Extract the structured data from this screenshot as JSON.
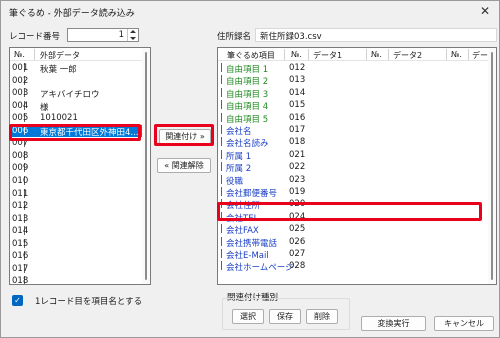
{
  "window": {
    "title": "筆ぐるめ - 外部データ読み込み",
    "close_glyph": "✕"
  },
  "record": {
    "label": "レコード番号",
    "value": "1"
  },
  "file": {
    "label": "住所録名",
    "value": "新住所録03.csv"
  },
  "left_list": {
    "headers": {
      "no": "№.",
      "data": "外部データ"
    },
    "rows": [
      {
        "no": "001",
        "text": "秋葉 一郎"
      },
      {
        "no": "002",
        "text": ""
      },
      {
        "no": "003",
        "text": "アキバイチロウ"
      },
      {
        "no": "004",
        "text": "様"
      },
      {
        "no": "005",
        "text": "1010021"
      },
      {
        "no": "006",
        "text": "東京都千代田区外神田4..."
      },
      {
        "no": "007",
        "text": ""
      },
      {
        "no": "008",
        "text": ""
      },
      {
        "no": "009",
        "text": ""
      },
      {
        "no": "010",
        "text": ""
      },
      {
        "no": "011",
        "text": ""
      },
      {
        "no": "012",
        "text": ""
      },
      {
        "no": "013",
        "text": ""
      },
      {
        "no": "014",
        "text": ""
      },
      {
        "no": "015",
        "text": ""
      },
      {
        "no": "016",
        "text": ""
      },
      {
        "no": "017",
        "text": ""
      },
      {
        "no": "018",
        "text": ""
      }
    ]
  },
  "right_list": {
    "headers": {
      "field": "筆ぐるめ項目",
      "no1": "№.",
      "data1": "データ1",
      "no2": "№.",
      "data2": "データ2",
      "no3": "№.",
      "data3": "データ"
    },
    "rows": [
      {
        "field": "自由項目 1",
        "no": "012",
        "color": "#1e8a1e"
      },
      {
        "field": "自由項目 2",
        "no": "013",
        "color": "#1e8a1e"
      },
      {
        "field": "自由項目 3",
        "no": "014",
        "color": "#1e8a1e"
      },
      {
        "field": "自由項目 4",
        "no": "015",
        "color": "#1e8a1e"
      },
      {
        "field": "自由項目 5",
        "no": "016",
        "color": "#1e8a1e"
      },
      {
        "field": "会社名",
        "no": "017",
        "color": "#1a3fc8"
      },
      {
        "field": "会社名読み",
        "no": "018",
        "color": "#1a3fc8"
      },
      {
        "field": "所属 1",
        "no": "021",
        "color": "#1a3fc8"
      },
      {
        "field": "所属 2",
        "no": "022",
        "color": "#1a3fc8"
      },
      {
        "field": "役職",
        "no": "023",
        "color": "#1a3fc8"
      },
      {
        "field": "会社郵便番号",
        "no": "019",
        "color": "#1a3fc8"
      },
      {
        "field": "会社住所",
        "no": "020",
        "color": "#1a3fc8"
      },
      {
        "field": "会社TEL",
        "no": "024",
        "color": "#1a3fc8"
      },
      {
        "field": "会社FAX",
        "no": "025",
        "color": "#1a3fc8"
      },
      {
        "field": "会社携帯電話",
        "no": "026",
        "color": "#1a3fc8"
      },
      {
        "field": "会社E-Mail",
        "no": "027",
        "color": "#1a3fc8"
      },
      {
        "field": "会社ホームページ",
        "no": "028",
        "color": "#1a3fc8"
      }
    ]
  },
  "buttons": {
    "link": "関連付け »",
    "unlink": "« 関連解除",
    "select": "選択",
    "save": "保存",
    "delete": "削除",
    "execute": "変換実行",
    "cancel": "キャンセル"
  },
  "checkbox": {
    "label": "1レコード目を項目名とする",
    "checked": true
  },
  "link_group": {
    "label": "関連付け種別"
  },
  "colors": {
    "selection": "#0078d7",
    "highlight_border": "#e8001c",
    "free_field": "#1e8a1e",
    "company_field": "#1a3fc8"
  }
}
